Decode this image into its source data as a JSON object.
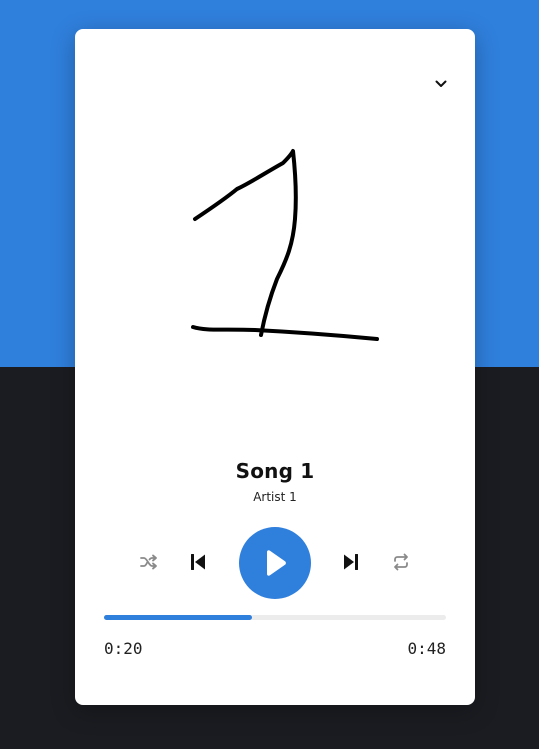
{
  "player": {
    "song_title": "Song 1",
    "artist": "Artist 1",
    "current_time": "0:20",
    "duration": "0:48",
    "progress_fraction": 0.433,
    "artwork_text": "1"
  },
  "icons": {
    "collapse": "chevron-down-icon",
    "shuffle": "shuffle-icon",
    "previous": "skip-previous-icon",
    "play": "play-icon",
    "next": "skip-next-icon",
    "repeat": "repeat-icon"
  },
  "colors": {
    "accent": "#2f7fdc",
    "background_top": "#2f7fdc",
    "background_bottom": "#1a1c21",
    "card": "#ffffff",
    "inactive_icon": "#8a8a8a",
    "active_icon": "#111111"
  }
}
